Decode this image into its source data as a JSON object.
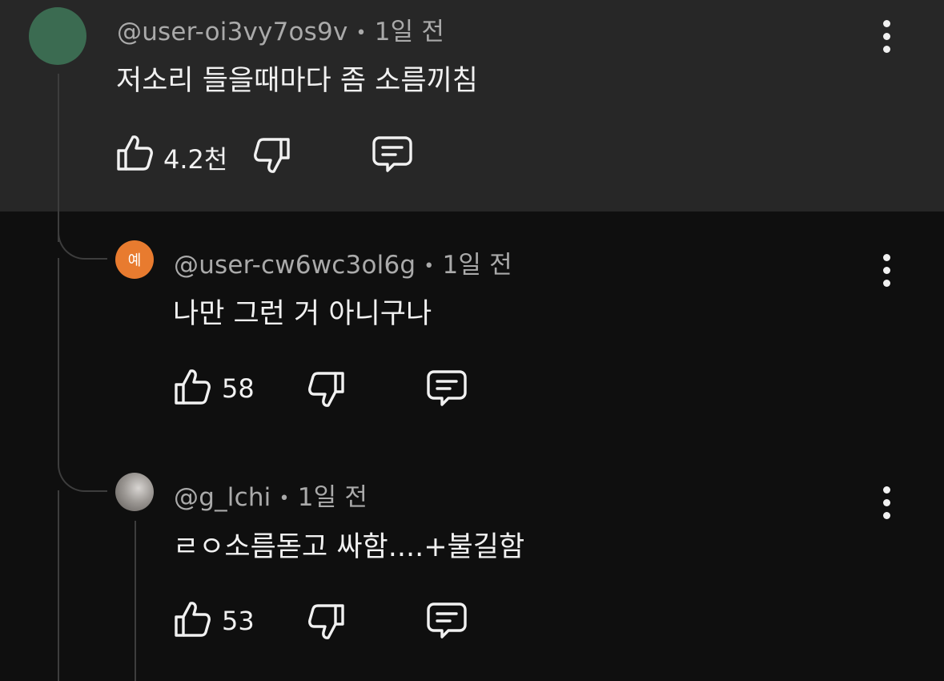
{
  "comments": [
    {
      "handle": "@user-oi3vy7os9v",
      "separator": "•",
      "time": "1일 전",
      "text": "저소리 들을때마다 좀 소름끼침",
      "likes": "4.2천",
      "avatar_color": "#3b6b51"
    },
    {
      "handle": "@user-cw6wc3ol6g",
      "separator": "•",
      "time": "1일 전",
      "text": "나만 그런 거 아니구나",
      "likes": "58",
      "avatar_initial": "예",
      "avatar_color": "#e87b2f"
    },
    {
      "handle": "@g_lchi",
      "separator": "•",
      "time": "1일 전",
      "text": "ㄹㅇ소름돋고 싸함....+불길함",
      "likes": "53",
      "avatar_color": "#9b9793"
    }
  ],
  "icons": {
    "like": "thumbs-up-icon",
    "dislike": "thumbs-down-icon",
    "reply": "reply-comment-icon",
    "more": "more-vertical-icon"
  },
  "colors": {
    "highlight_background": "#272727",
    "background": "#0f0f0f",
    "meta_text": "#aaaaaa",
    "thread_line": "#3d3d3d"
  }
}
